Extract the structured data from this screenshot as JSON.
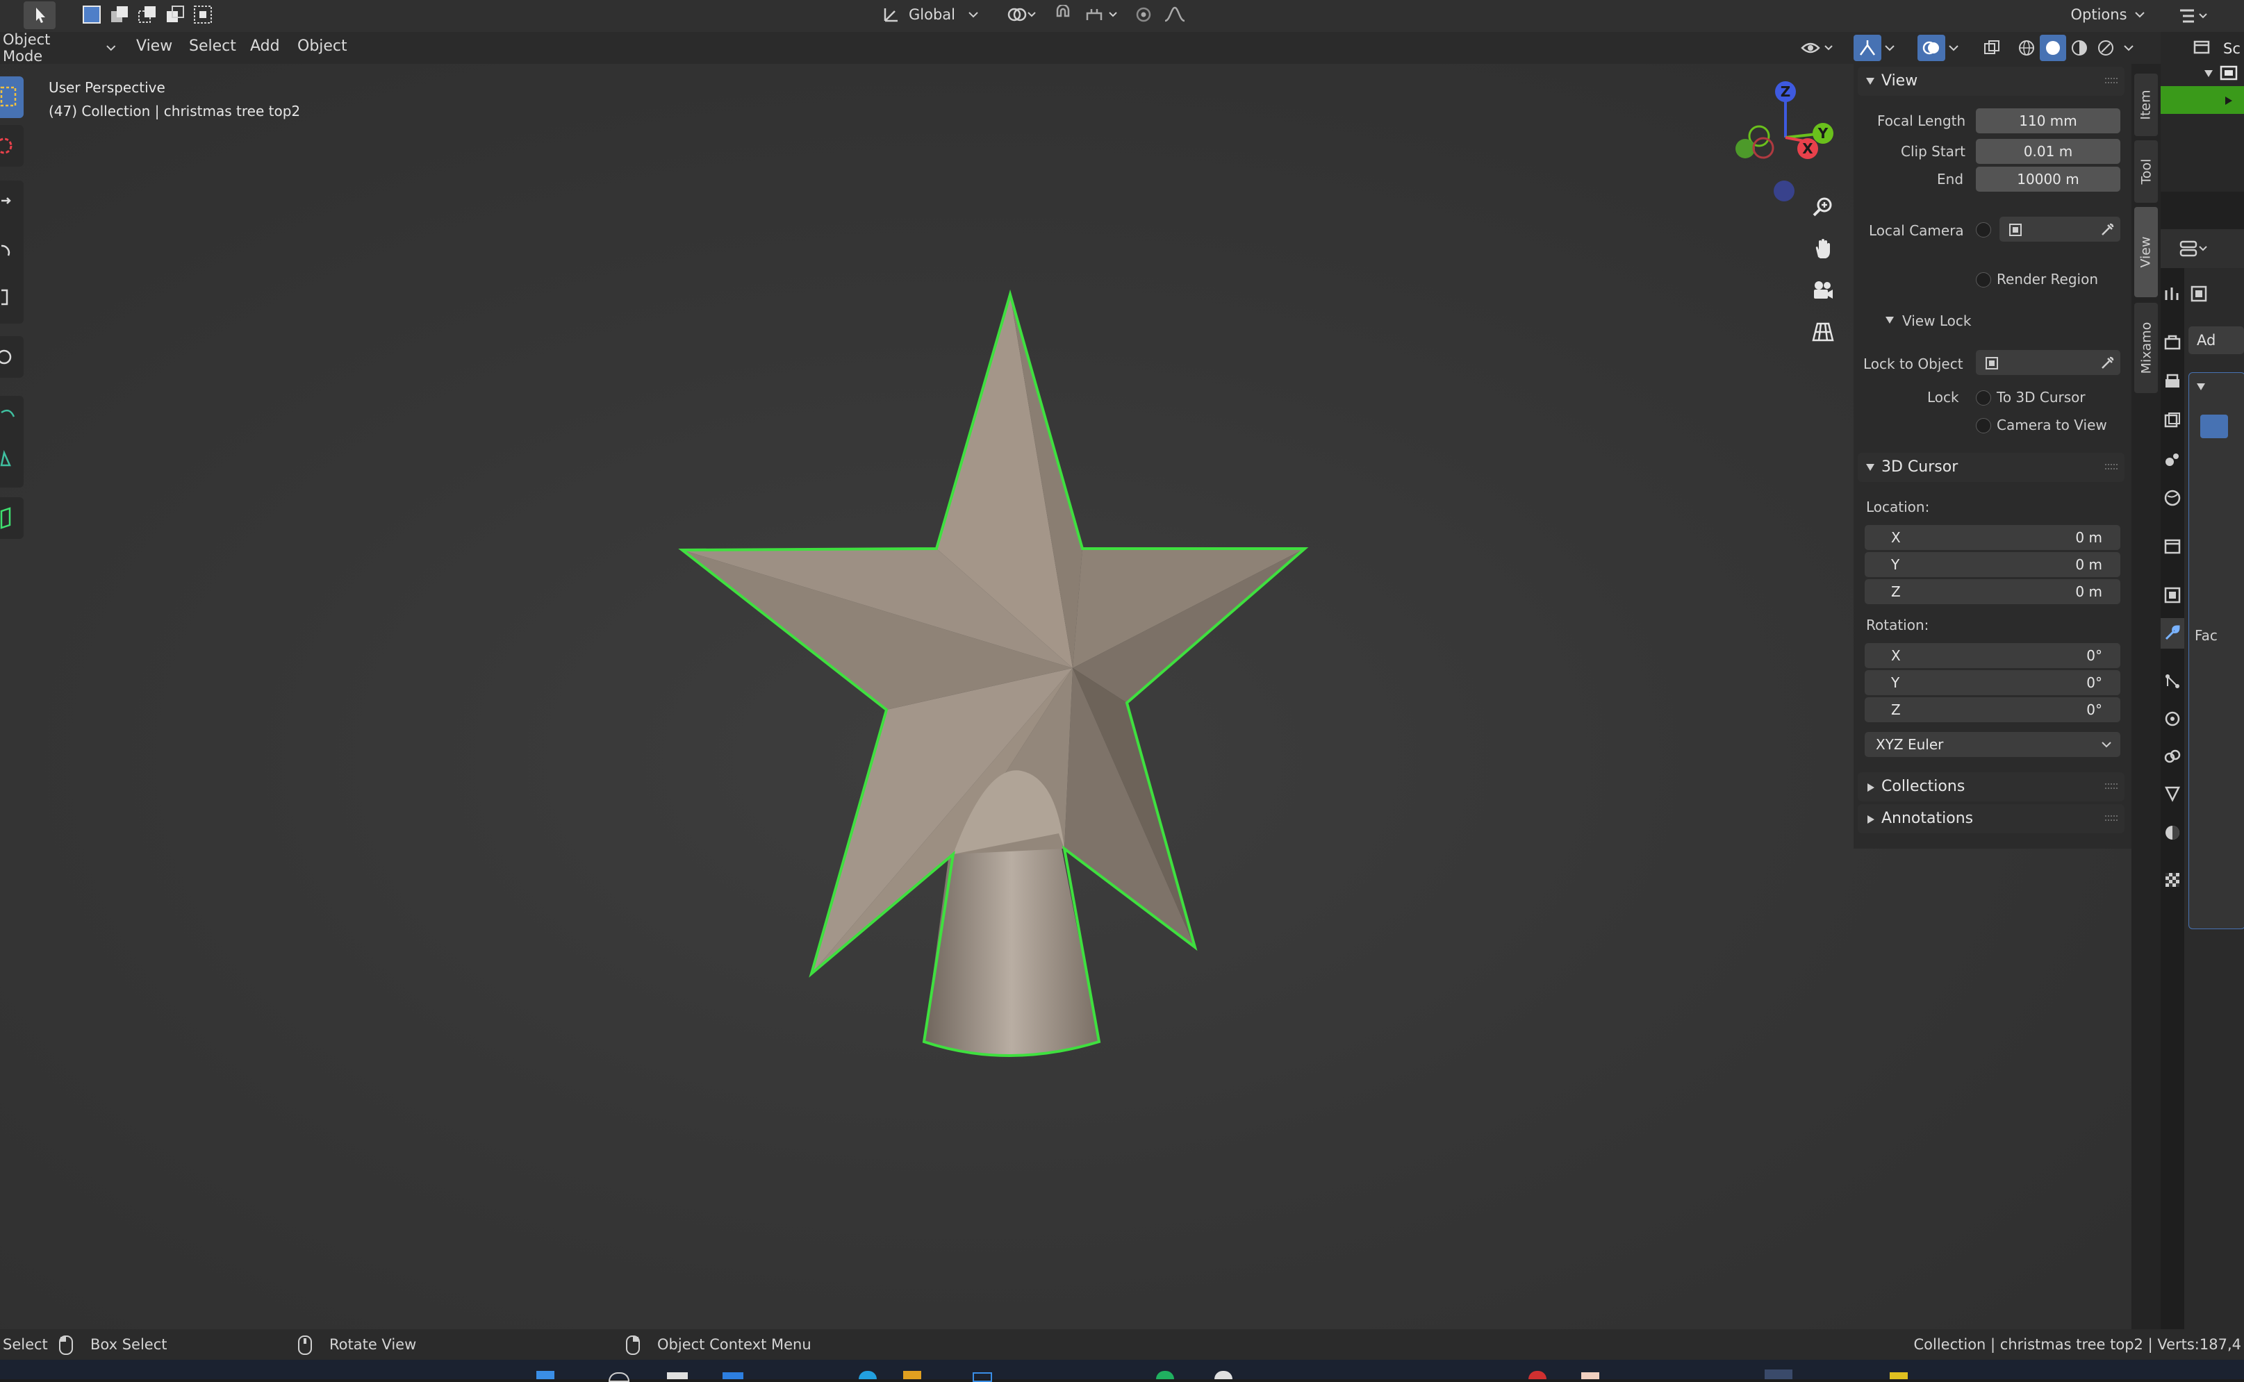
{
  "header": {
    "mode": "Object Mode",
    "menus": [
      "View",
      "Select",
      "Add",
      "Object"
    ],
    "transform_orientation": "Global",
    "options": "Options"
  },
  "viewport": {
    "perspective": "User Perspective",
    "collection_info": "(47) Collection | christmas tree top2",
    "gizmo": {
      "x": "X",
      "y": "Y",
      "z": "Z"
    }
  },
  "view_panel": {
    "title": "View",
    "focal_length_label": "Focal Length",
    "focal_length": "110 mm",
    "clip_start_label": "Clip Start",
    "clip_start": "0.01 m",
    "clip_end_label": "End",
    "clip_end": "10000 m",
    "local_camera_label": "Local Camera",
    "render_region_label": "Render Region",
    "view_lock_title": "View Lock",
    "lock_to_object_label": "Lock to Object",
    "lock_label": "Lock",
    "to_3d_cursor_label": "To 3D Cursor",
    "camera_to_view_label": "Camera to View"
  },
  "cursor_panel": {
    "title": "3D Cursor",
    "location_label": "Location:",
    "location": [
      {
        "axis": "X",
        "value": "0 m"
      },
      {
        "axis": "Y",
        "value": "0 m"
      },
      {
        "axis": "Z",
        "value": "0 m"
      }
    ],
    "rotation_label": "Rotation:",
    "rotation": [
      {
        "axis": "X",
        "value": "0°"
      },
      {
        "axis": "Y",
        "value": "0°"
      },
      {
        "axis": "Z",
        "value": "0°"
      }
    ],
    "rotation_mode": "XYZ Euler"
  },
  "collections_title": "Collections",
  "annotations_title": "Annotations",
  "side_tabs": [
    "Item",
    "Tool",
    "View",
    "Mixamo"
  ],
  "active_tab": "View",
  "right_fragments": {
    "scene": "Sc",
    "add": "Ad",
    "face": "Fac"
  },
  "status": {
    "select": "Select",
    "box_select": "Box Select",
    "rotate_view": "Rotate View",
    "context_menu": "Object Context Menu",
    "right_info": "Collection | christmas tree top2 | Verts:187,4"
  },
  "colors": {
    "selection_outline": "#3fe03f",
    "accent_blue": "#4772b3",
    "star_fill": "#8f8377",
    "gizmo_x": "#e8414b",
    "gizmo_y": "#6ac01c",
    "gizmo_z": "#3e5ae0"
  }
}
